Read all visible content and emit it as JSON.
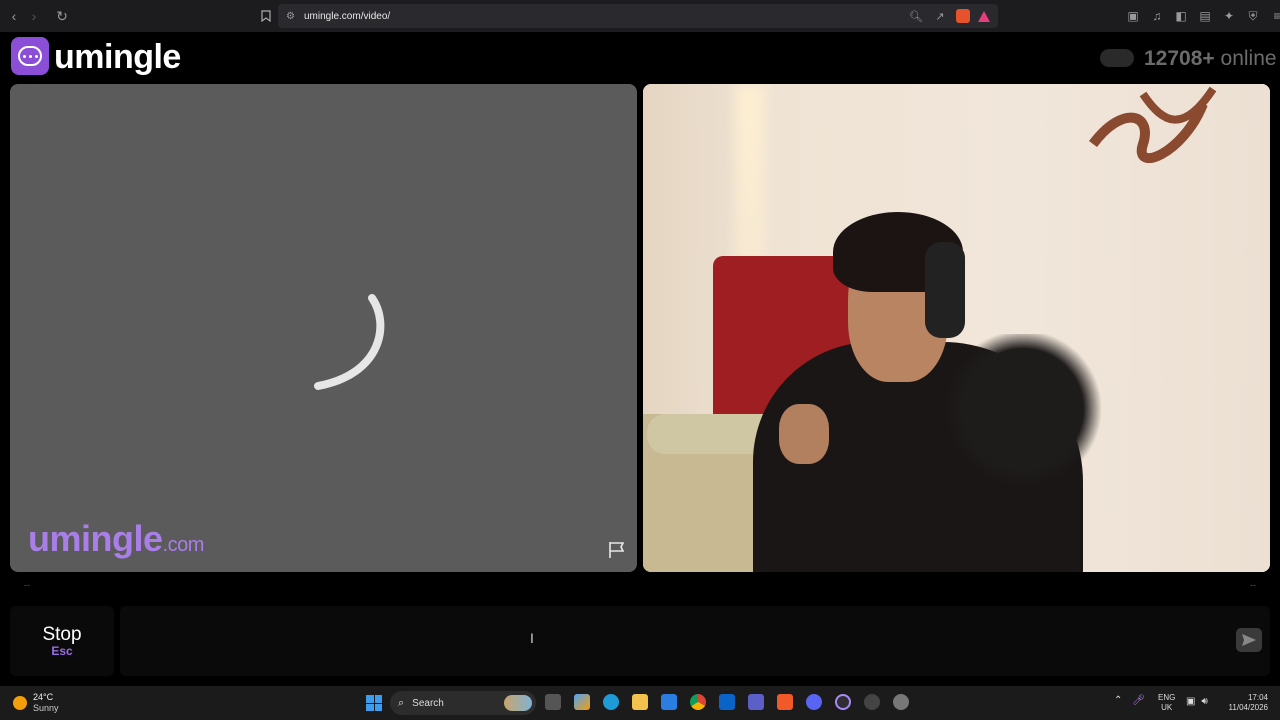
{
  "browser": {
    "url": "umingle.com/video/",
    "back_icon": "back-arrow-icon",
    "forward_icon": "forward-arrow-icon",
    "reload_icon": "reload-icon",
    "bookmark_icon": "bookmark-icon"
  },
  "site": {
    "logo_text": "umingle",
    "online_count": "12708+",
    "online_label": "online",
    "accent_color": "#8a4fd6"
  },
  "stranger_panel": {
    "watermark_main": "umingle",
    "watermark_suffix": ".com",
    "status": "loading"
  },
  "self_panel": {
    "status": "camera-live"
  },
  "status_strip": {
    "left": "--",
    "right": "--"
  },
  "chat": {
    "stop_label": "Stop",
    "stop_key": "Esc",
    "input_value": ""
  },
  "taskbar": {
    "weather_temp": "24°C",
    "weather_desc": "Sunny",
    "search_label": "Search",
    "lang_top": "ENG",
    "lang_bottom": "UK",
    "time": "17:04",
    "date": "11/04/2026"
  }
}
